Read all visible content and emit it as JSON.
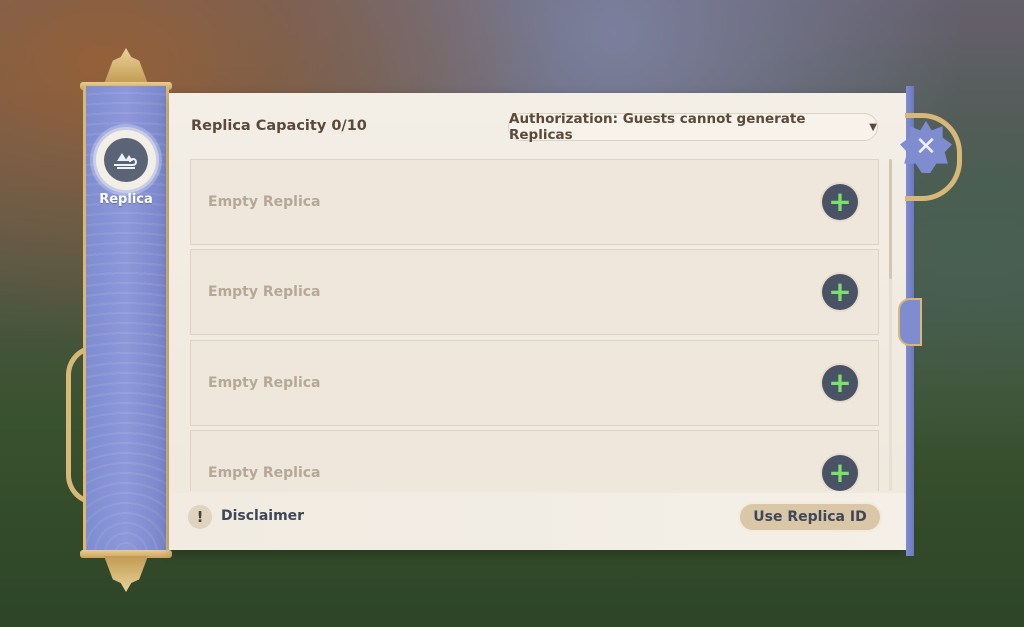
{
  "sidebar": {
    "label": "Replica"
  },
  "header": {
    "capacity": "Replica Capacity 0/10",
    "authorization": "Authorization: Guests cannot generate Replicas"
  },
  "slots": [
    {
      "label": "Empty Replica"
    },
    {
      "label": "Empty Replica"
    },
    {
      "label": "Empty Replica"
    },
    {
      "label": "Empty Replica"
    }
  ],
  "footer": {
    "disclaimer": "Disclaimer",
    "use_id": "Use Replica ID"
  },
  "icons": {
    "emblem": "replica-emblem-icon",
    "close": "close-icon",
    "add": "plus-icon",
    "disclaimer": "exclamation-icon"
  },
  "colors": {
    "accent_blue": "#7f8cd0",
    "gold_trim": "#d8b878",
    "panel_bg": "#f3eee6",
    "add_plus": "#7ee06c"
  }
}
